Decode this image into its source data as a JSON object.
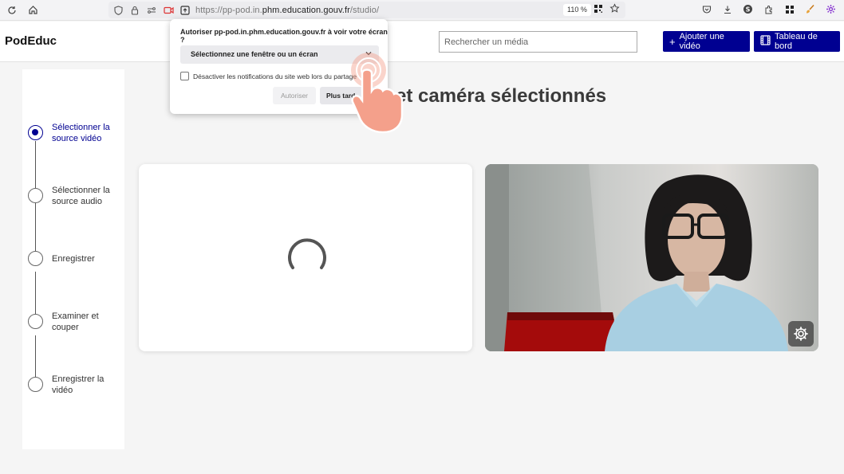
{
  "browser": {
    "url_prefix": "https://pp-pod.in.",
    "url_domain": "phm.education.gouv.fr",
    "url_path": "/studio/",
    "zoom": "110 %"
  },
  "header": {
    "logo": "PodEduc",
    "search_placeholder": "Rechercher un média",
    "add_video_label": "Ajouter une vidéo",
    "dashboard_label": "Tableau de bord",
    "accent_color": "#000091"
  },
  "popup": {
    "title": "Autoriser pp-pod.in.phm.education.gouv.fr à voir votre écran ?",
    "select_value": "Sélectionnez une fenêtre ou un écran",
    "checkbox_label": "Désactiver les notifications du site web lors du partage",
    "allow_label": "Autoriser",
    "later_label": "Plus tard"
  },
  "steps": [
    {
      "label": "Sélectionner la source vidéo",
      "active": true
    },
    {
      "label": "Sélectionner la source audio",
      "active": false
    },
    {
      "label": "Enregistrer",
      "active": false
    },
    {
      "label": "Examiner et couper",
      "active": false
    },
    {
      "label": "Enregistrer la vidéo",
      "active": false
    }
  ],
  "main": {
    "title": "et caméra sélectionnés"
  }
}
